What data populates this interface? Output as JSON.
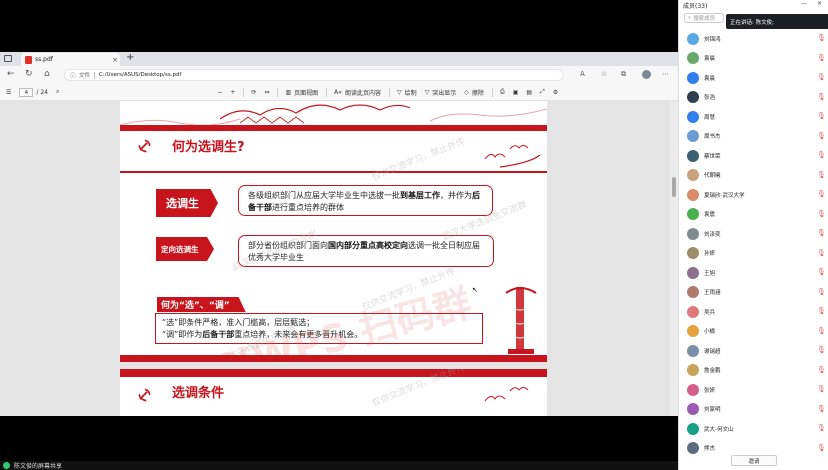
{
  "browser": {
    "tab_title": "ss.pdf",
    "url_scheme": "文件",
    "url": "C:/Users/ASUS/Desktop/ss.pdf",
    "pdf_toolbar": {
      "page_current": "4",
      "page_total": "/ 24",
      "zoom_out": "−",
      "zoom_in": "+",
      "page_view": "页面视图",
      "read_aloud": "朗读此页内容",
      "draw": "绘制",
      "highlight": "突出显示",
      "erase": "擦除"
    }
  },
  "slide1": {
    "title": "何为选调生?",
    "label1": "选调生",
    "def1_pre": "各级组织部门从应届大学毕业生中选拔一批",
    "def1_b1": "到基层工作",
    "def1_mid": "，并作为",
    "def1_b2": "后备干部",
    "def1_post": "进行重点培养的群体",
    "label2": "定向选调生",
    "def2_pre": "部分省份组织部门面向",
    "def2_b1": "国内部分重点高校定向",
    "def2_post": "选调一批全日制应届优秀大学毕业生",
    "sub_title": "何为“选”、“调”",
    "sub_line1": "“选”即条件严格，准入门槛高，层层甄选；",
    "sub_line2_pre": "“调”即作为",
    "sub_line2_b": "后备干部",
    "sub_line2_post": "重点培养，未来会有更多晋升机会。"
  },
  "watermarks": {
    "text1": "仅供交流学习，禁止外传",
    "text2": "武汉大学选调生交流群",
    "big": "XWPS 扫码群"
  },
  "slide2": {
    "title": "选调条件"
  },
  "taskbar": {
    "text": "陈文俊的屏幕共享"
  },
  "panel": {
    "title": "成员(33)",
    "search_placeholder": "搜索成员",
    "speaking": "正在讲话: 陈文俊;",
    "invite": "邀请",
    "members": [
      {
        "name": "刘锦鸿",
        "color": "#5aa9e6"
      },
      {
        "name": "袁晨",
        "color": "#6aa86e"
      },
      {
        "name": "袁晨",
        "color": "#2f80ed"
      },
      {
        "name": "张浩",
        "color": "#2c3e50"
      },
      {
        "name": "周慧",
        "color": "#2f80ed"
      },
      {
        "name": "周书杰",
        "color": "#6d9bd1"
      },
      {
        "name": "蔡世荣",
        "color": "#3a6073"
      },
      {
        "name": "代朝曦",
        "color": "#c9a27e"
      },
      {
        "name": "夏瑞欣-武汉大学",
        "color": "#d98c6a"
      },
      {
        "name": "袁震",
        "color": "#4caf50"
      },
      {
        "name": "刘泽奕",
        "color": "#7f8c8d"
      },
      {
        "name": "孙妍",
        "color": "#9c8d6b"
      },
      {
        "name": "王旭",
        "color": "#8e6f8e"
      },
      {
        "name": "王雨涵",
        "color": "#b07b6e"
      },
      {
        "name": "吴兵",
        "color": "#e07a7a"
      },
      {
        "name": "小橘",
        "color": "#e6a23c"
      },
      {
        "name": "谢瑞超",
        "color": "#7a8fa6"
      },
      {
        "name": "詹金鹏",
        "color": "#c8a35a"
      },
      {
        "name": "张妍",
        "color": "#d4608a"
      },
      {
        "name": "刘家明",
        "color": "#9b59b6"
      },
      {
        "name": "武大-何文山",
        "color": "#16a085"
      },
      {
        "name": "熊杰",
        "color": "#5d6d7e"
      }
    ]
  }
}
